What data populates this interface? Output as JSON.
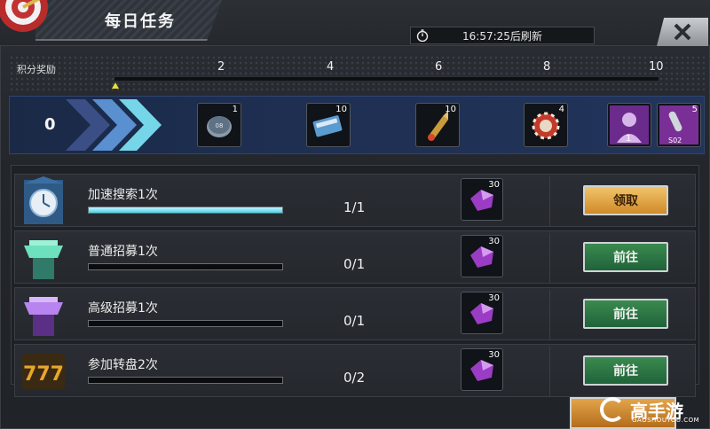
{
  "header": {
    "title": "每日任务",
    "refresh_text": "16:57:25后刷新"
  },
  "score": {
    "label": "积分奖励",
    "ticks": [
      "2",
      "4",
      "6",
      "8",
      "10"
    ],
    "current": "0"
  },
  "rewards": [
    {
      "icon": "token-coin-icon",
      "count": "1"
    },
    {
      "icon": "ticket-card-icon",
      "count": "10"
    },
    {
      "icon": "bullet-ammo-icon",
      "count": "10"
    },
    {
      "icon": "casino-chip-icon",
      "count": "4"
    },
    {
      "icon": "silhouette-card-icon",
      "count": "1"
    },
    {
      "icon": "microphone-card-icon",
      "count": "5"
    }
  ],
  "tasks": [
    {
      "name": "加速搜索1次",
      "progress": "1/1",
      "progress_fraction": 1.0,
      "gem_count": "30",
      "button": "领取",
      "button_type": "claim",
      "icon": "clock-tower-icon"
    },
    {
      "name": "普通招募1次",
      "progress": "0/1",
      "progress_fraction": 0.0,
      "gem_count": "30",
      "button": "前往",
      "button_type": "go",
      "icon": "green-recruit-icon"
    },
    {
      "name": "高级招募1次",
      "progress": "0/1",
      "progress_fraction": 0.0,
      "gem_count": "30",
      "button": "前往",
      "button_type": "go",
      "icon": "purple-recruit-icon"
    },
    {
      "name": "参加转盘2次",
      "progress": "0/2",
      "progress_fraction": 0.0,
      "gem_count": "30",
      "button": "前往",
      "button_type": "go",
      "icon": "slot-777-icon"
    }
  ],
  "colors": {
    "claim": "#d08a2a",
    "go": "#20633a",
    "progress": "#4fd2e7",
    "reward_strip": "#1e2f52"
  },
  "watermark": {
    "text": "高手游",
    "sub": "GAOSHOUYOU.COM"
  }
}
